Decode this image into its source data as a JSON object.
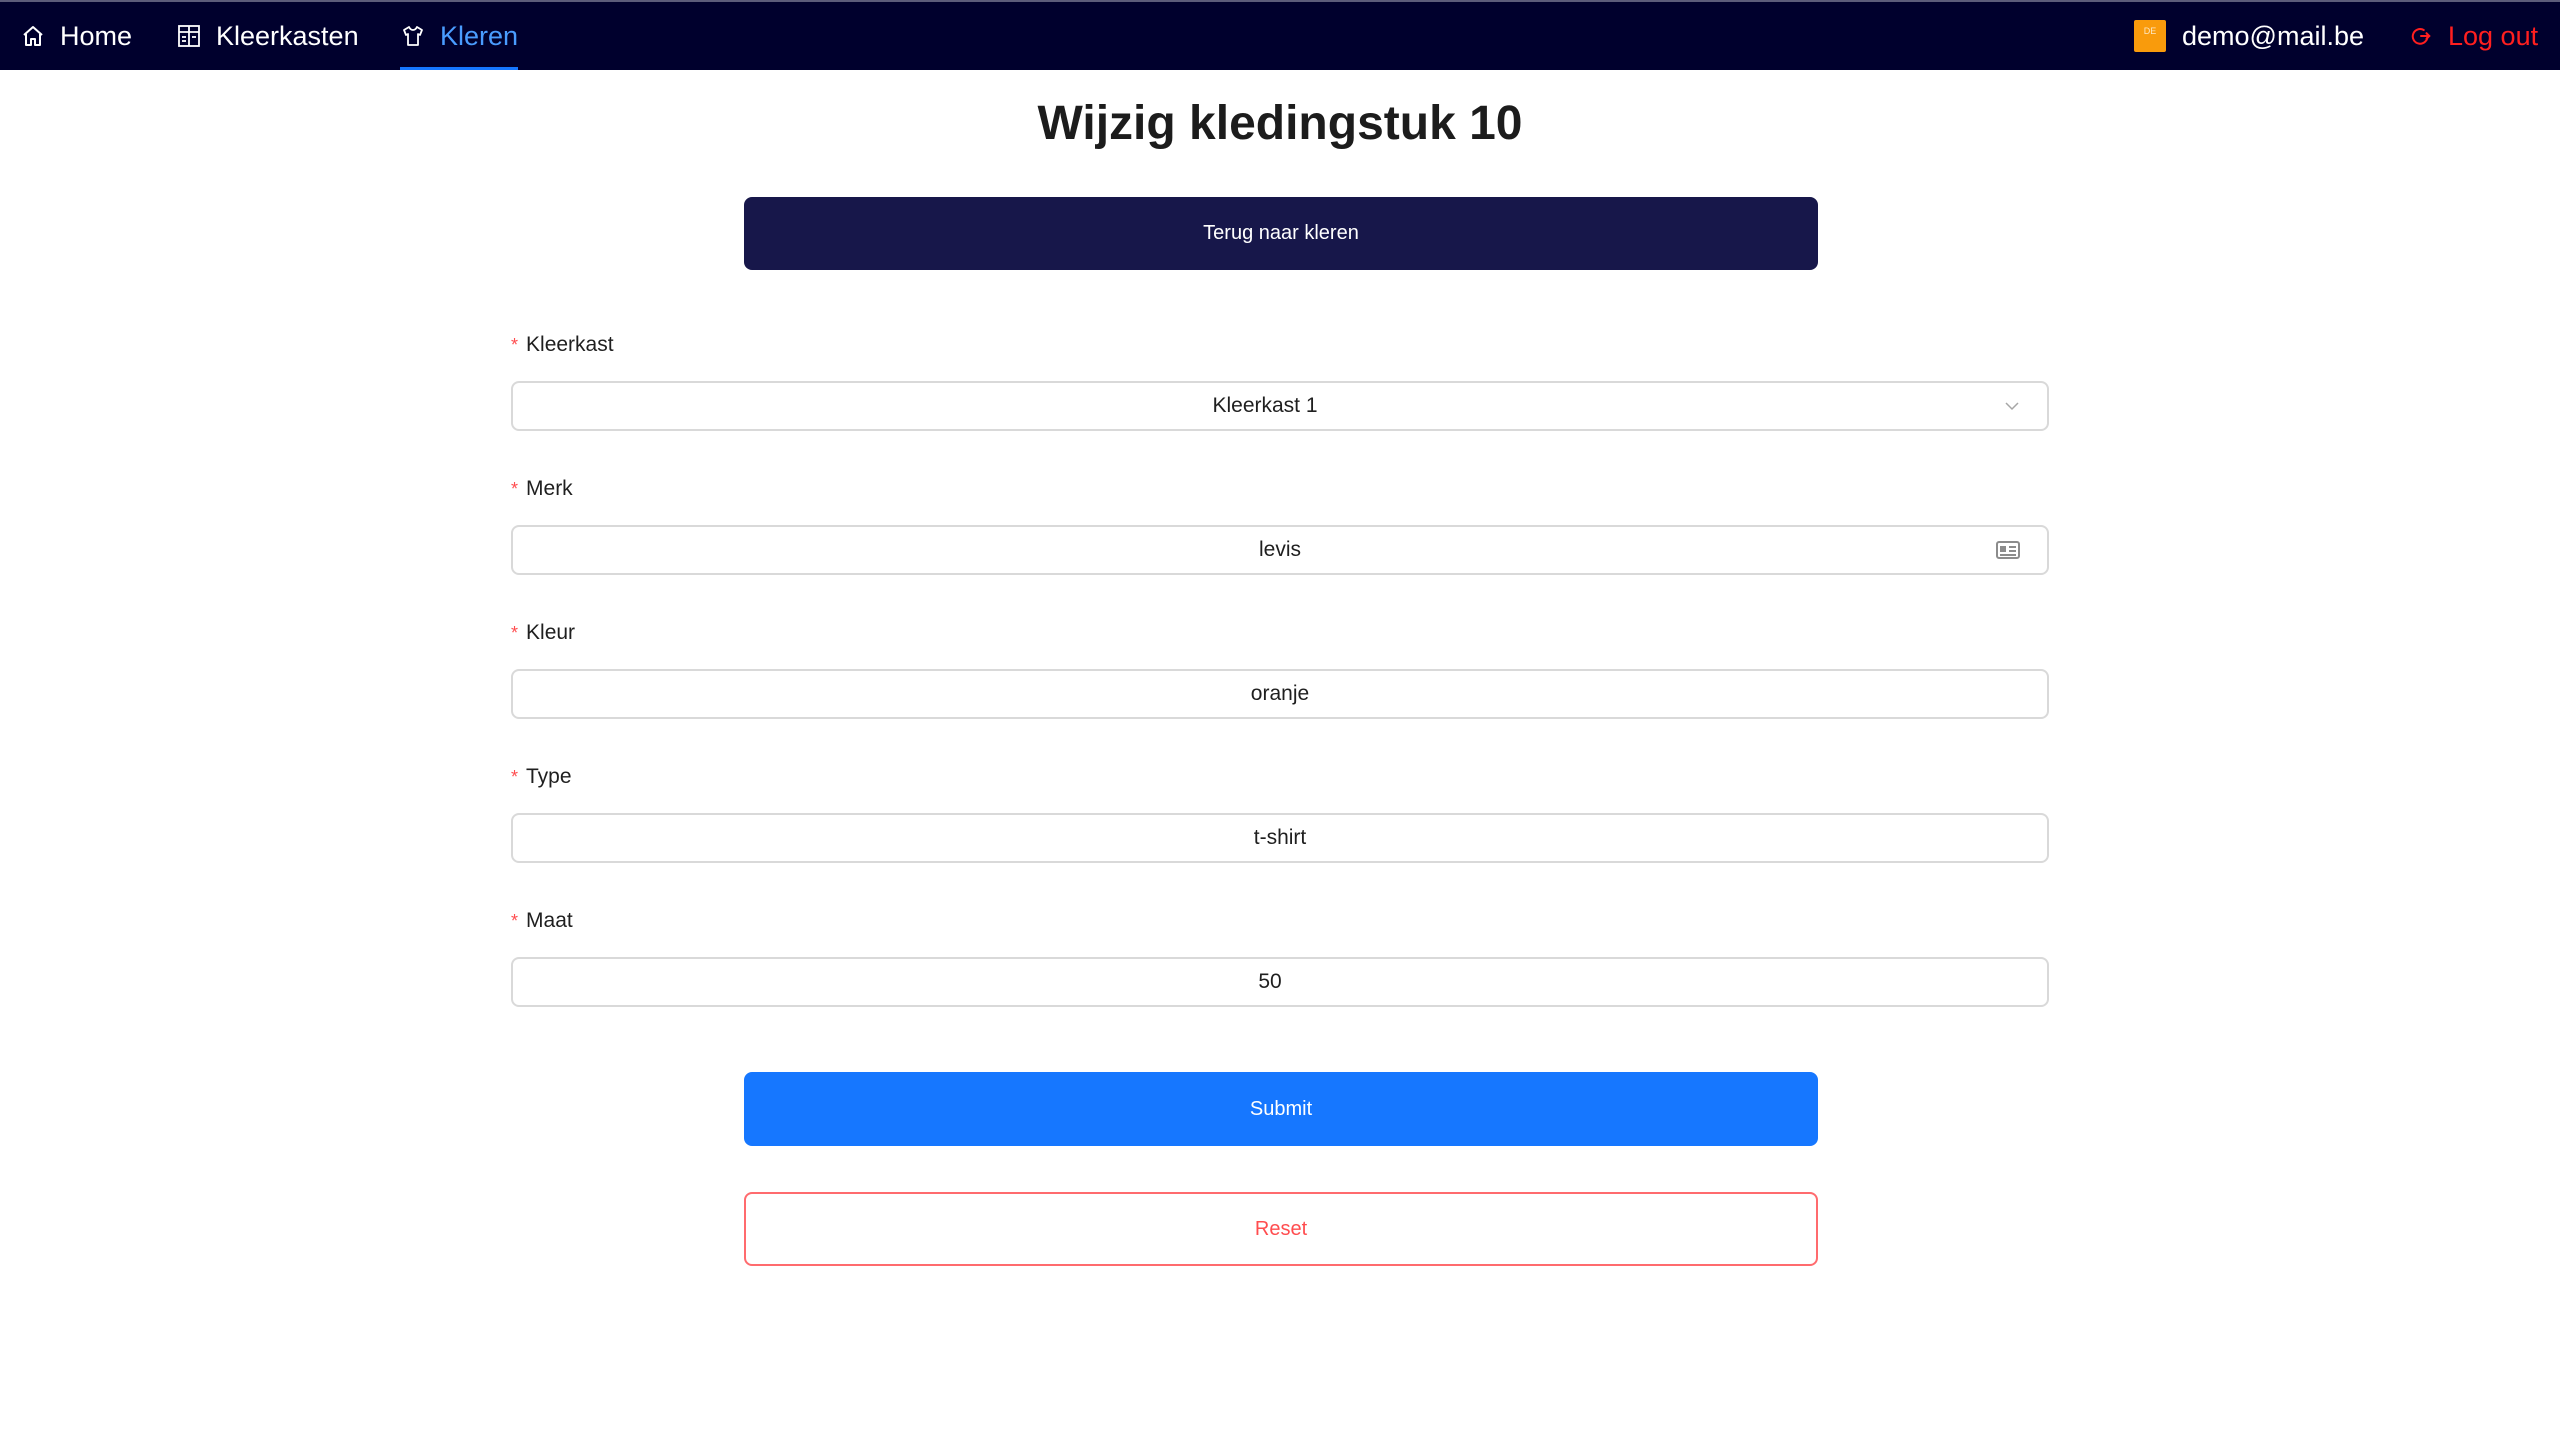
{
  "nav": {
    "home": {
      "label": "Home",
      "icon": "home-icon"
    },
    "kleerkasten": {
      "label": "Kleerkasten",
      "icon": "wardrobe-icon"
    },
    "kleren": {
      "label": "Kleren",
      "icon": "shirt-icon",
      "active": true
    },
    "user": {
      "email": "demo@mail.be",
      "badge_text": "DE",
      "badge_color": "#f99b0c"
    },
    "logout": {
      "label": "Log out",
      "icon": "logout-icon",
      "color": "#ff1f1f"
    }
  },
  "page": {
    "title": "Wijzig kledingstuk 10",
    "back_button": "Terug naar kleren"
  },
  "form": {
    "kleerkast": {
      "label": "Kleerkast",
      "required": true,
      "value": "Kleerkast 1",
      "icon": "chevron-down-icon"
    },
    "merk": {
      "label": "Merk",
      "required": true,
      "value": "levis",
      "icon": "contact-card-icon"
    },
    "kleur": {
      "label": "Kleur",
      "required": true,
      "value": "oranje"
    },
    "type": {
      "label": "Type",
      "required": true,
      "value": "t-shirt"
    },
    "maat": {
      "label": "Maat",
      "required": true,
      "value": "50"
    },
    "required_mark": "*",
    "submit": "Submit",
    "reset": "Reset"
  },
  "colors": {
    "navbar": "#00002d",
    "primary": "#1677ff",
    "back_button": "#17174a",
    "danger": "#ff4d4f"
  }
}
